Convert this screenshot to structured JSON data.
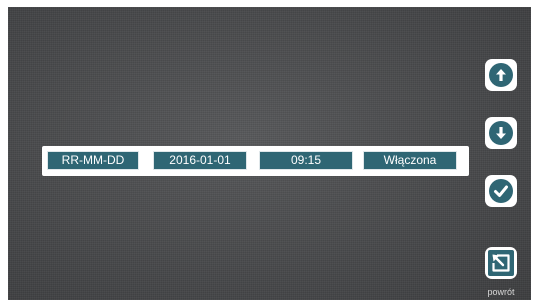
{
  "fields": {
    "date_format": "RR-MM-DD",
    "date": "2016-01-01",
    "time": "09:15",
    "state": "Włączona"
  },
  "nav": {
    "up_icon": "arrow-up-circle-icon",
    "down_icon": "arrow-down-circle-icon",
    "confirm_icon": "checkmark-circle-icon",
    "back_icon": "back-arrow-icon",
    "back_label": "powrót"
  },
  "colors": {
    "accent": "#2f6674",
    "background": "#4a4b4d",
    "panel": "#ffffff"
  }
}
